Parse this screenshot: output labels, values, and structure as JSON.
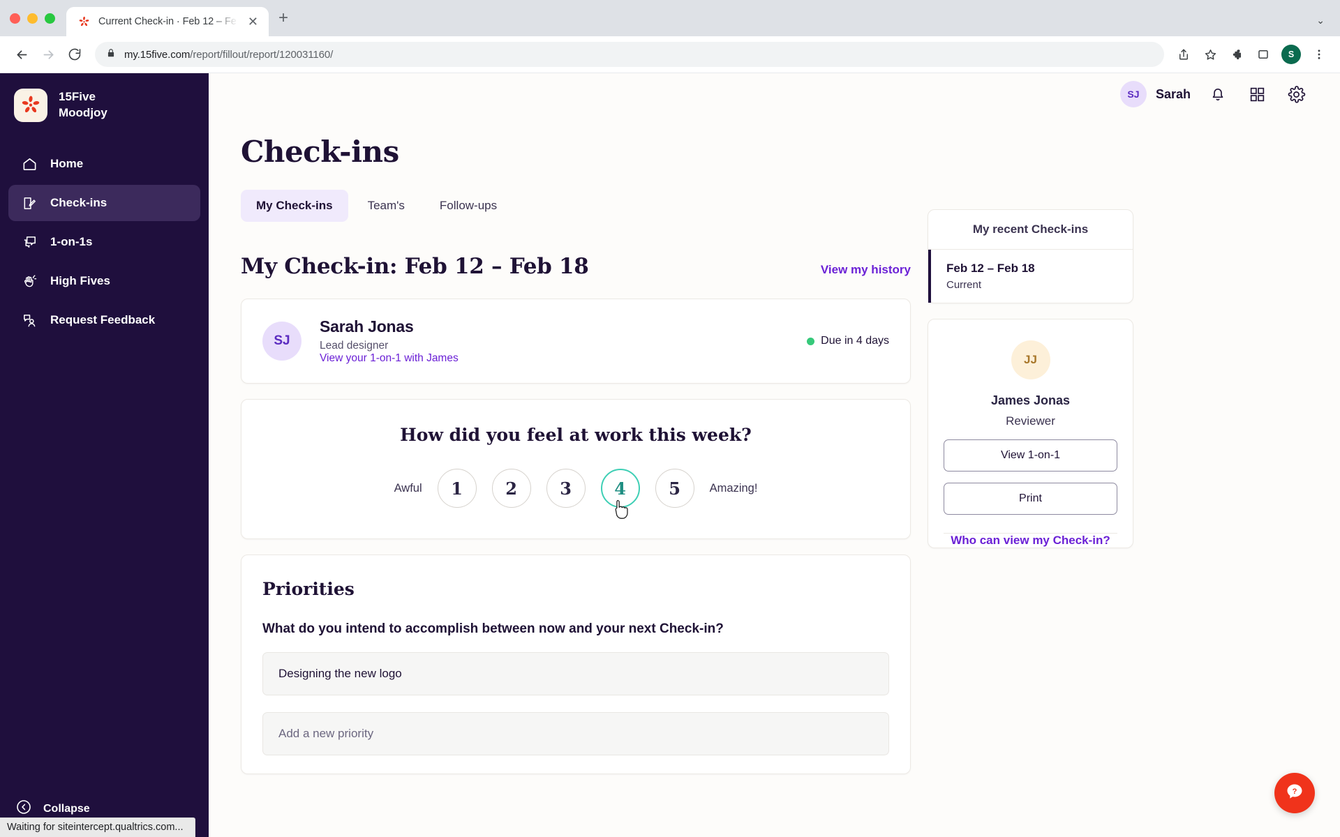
{
  "browser": {
    "tab": {
      "title": "Current Check-in · Feb 12 – Fe",
      "favicon_name": "15five-favicon",
      "close_label": "✕"
    },
    "new_tab_label": "+",
    "tabstrip_chevron": "⌄",
    "omnibox": {
      "host": "my.15five.com",
      "path": "/report/fillout/report/120031160/",
      "lock_icon": "lock-icon"
    },
    "profile_initial": "S",
    "status_text": "Waiting for siteintercept.qualtrics.com..."
  },
  "sidebar": {
    "brand_name": "15Five",
    "brand_org": "Moodjoy",
    "items": [
      {
        "label": "Home",
        "icon": "home-icon"
      },
      {
        "label": "Check-ins",
        "icon": "checkin-icon"
      },
      {
        "label": "1-on-1s",
        "icon": "chat-icon"
      },
      {
        "label": "High Fives",
        "icon": "high-five-icon"
      },
      {
        "label": "Request Feedback",
        "icon": "request-feedback-icon"
      }
    ],
    "collapse_label": "Collapse"
  },
  "topbar": {
    "user_initials": "SJ",
    "user_name": "Sarah",
    "icons": [
      "bell-icon",
      "apps-grid-icon",
      "gear-icon"
    ]
  },
  "main": {
    "page_title": "Check-ins",
    "tabs": [
      {
        "label": "My Check-ins",
        "active": true
      },
      {
        "label": "Team's",
        "active": false
      },
      {
        "label": "Follow-ups",
        "active": false
      }
    ],
    "section_title": "My Check-in: Feb 12 – Feb 18",
    "history_link": "View my history",
    "person": {
      "initials": "SJ",
      "name": "Sarah Jonas",
      "role": "Lead designer",
      "link": "View your 1-on-1 with James",
      "due_status": "Due in 4 days",
      "due_color": "#36c97a"
    },
    "mood": {
      "question": "How did you feel at work this week?",
      "low_label": "Awful",
      "high_label": "Amazing!",
      "options": [
        "1",
        "2",
        "3",
        "4",
        "5"
      ],
      "selected": "4",
      "selected_color": "#3fcfb5"
    },
    "priorities": {
      "title": "Priorities",
      "question": "What do you intend to accomplish between now and your next Check-in?",
      "items": [
        "Designing the new logo"
      ],
      "new_placeholder": "Add a new priority"
    }
  },
  "right": {
    "recent_title": "My recent Check-ins",
    "recent_items": [
      {
        "range": "Feb 12 – Feb 18",
        "status": "Current"
      }
    ],
    "reviewer": {
      "initials": "JJ",
      "name": "James Jonas",
      "role": "Reviewer",
      "buttons": [
        "View 1-on-1",
        "Print"
      ]
    },
    "who_link": "Who can view my Check-in?"
  },
  "help": {
    "icon": "help-question-icon",
    "color": "#f0331b"
  }
}
